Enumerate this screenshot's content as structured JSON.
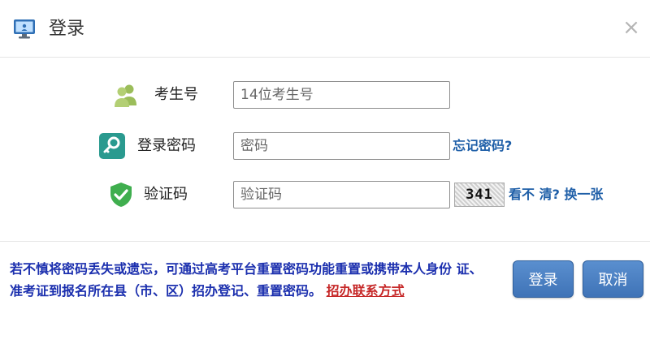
{
  "window": {
    "title": "登录",
    "close_symbol": "×",
    "icon": "monitor-icon"
  },
  "form": {
    "candidate": {
      "label": "考生号",
      "placeholder": "14位考生号",
      "icon": "users-icon"
    },
    "password": {
      "label": "登录密码",
      "placeholder": "密码",
      "icon": "key-icon",
      "forgot_link": "忘记密码?"
    },
    "captcha": {
      "label": "验证码",
      "placeholder": "验证码",
      "icon": "shield-check-icon",
      "image_text": "341",
      "refresh_link": "看不 清? 换一张"
    }
  },
  "notice": {
    "text": "若不慎将密码丢失或遗忘，可通过高考平台重置密码功能重置或携带本人身份 证、准考证到报名所在县（市、区）招办登记、重置密码。",
    "contact_link": "招办联系方式"
  },
  "buttons": {
    "login": "登录",
    "cancel": "取消"
  },
  "colors": {
    "accent": "#3f73b7",
    "link": "#1f5fa8",
    "notice": "#1b2fae",
    "contact": "#c62828"
  }
}
